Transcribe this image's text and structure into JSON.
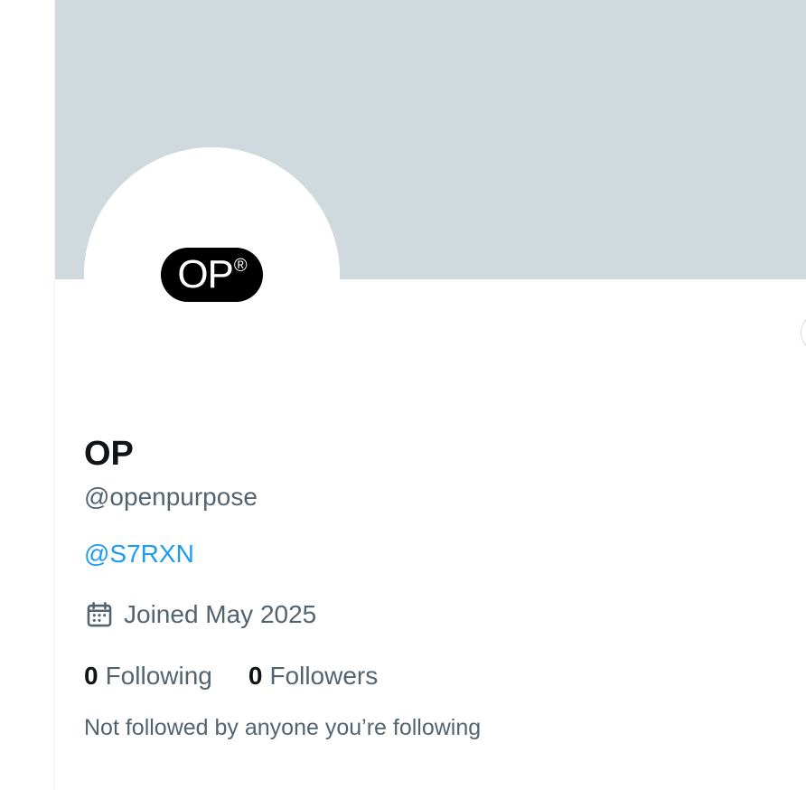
{
  "profile": {
    "display_name": "OP",
    "handle": "@openpurpose",
    "bio_mention": "@S7RXN",
    "joined": "Joined May 2025",
    "avatar_logo_text": "OP",
    "avatar_logo_mark": "®"
  },
  "stats": {
    "following_count": "0",
    "following_label": "Following",
    "followers_count": "0",
    "followers_label": "Followers"
  },
  "social_context": "Not followed by anyone you’re following",
  "icons": {
    "joined": "calendar-icon"
  },
  "colors": {
    "banner": "#cfd9de",
    "primary_text": "#0f1419",
    "secondary_text": "#536471",
    "link": "#1d9bf0",
    "border": "#eff3f4",
    "logo_bg": "#000000",
    "logo_text": "#ffffff"
  }
}
